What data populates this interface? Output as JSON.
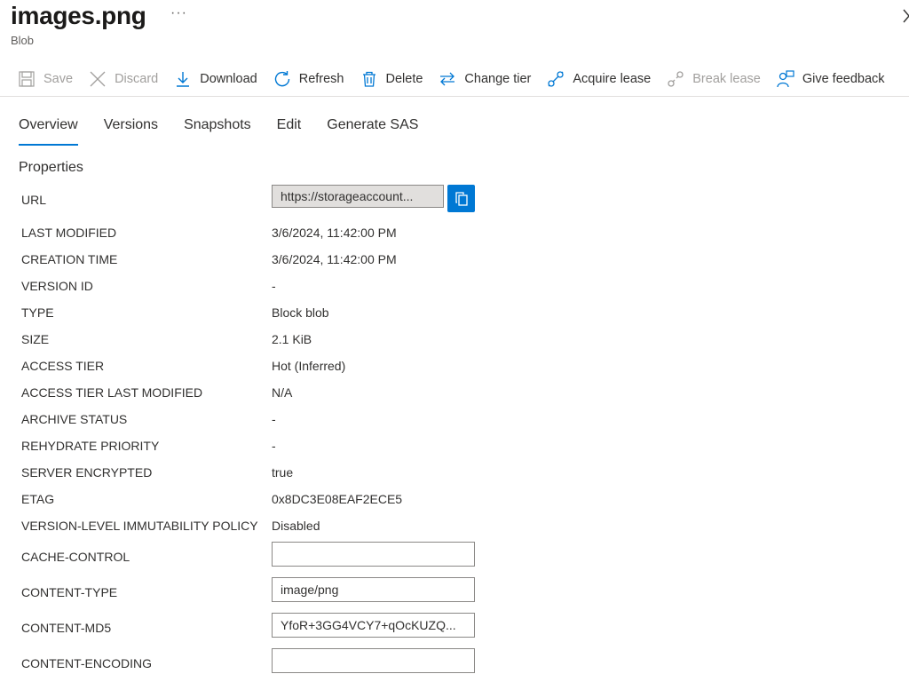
{
  "header": {
    "title": "images.png",
    "more": "···",
    "subtitle": "Blob"
  },
  "toolbar": {
    "save": "Save",
    "discard": "Discard",
    "download": "Download",
    "refresh": "Refresh",
    "delete": "Delete",
    "change_tier": "Change tier",
    "acquire_lease": "Acquire lease",
    "break_lease": "Break lease",
    "give_feedback": "Give feedback"
  },
  "tabs": [
    "Overview",
    "Versions",
    "Snapshots",
    "Edit",
    "Generate SAS"
  ],
  "section_title": "Properties",
  "properties": {
    "url_label": "URL",
    "url_value": "https://storageaccount...",
    "last_modified_label": "LAST MODIFIED",
    "last_modified_value": "3/6/2024, 11:42:00 PM",
    "creation_time_label": "CREATION TIME",
    "creation_time_value": "3/6/2024, 11:42:00 PM",
    "version_id_label": "VERSION ID",
    "version_id_value": "-",
    "type_label": "TYPE",
    "type_value": "Block blob",
    "size_label": "SIZE",
    "size_value": "2.1 KiB",
    "access_tier_label": "ACCESS TIER",
    "access_tier_value": "Hot (Inferred)",
    "access_tier_last_modified_label": "ACCESS TIER LAST MODIFIED",
    "access_tier_last_modified_value": "N/A",
    "archive_status_label": "ARCHIVE STATUS",
    "archive_status_value": "-",
    "rehydrate_priority_label": "REHYDRATE PRIORITY",
    "rehydrate_priority_value": "-",
    "server_encrypted_label": "SERVER ENCRYPTED",
    "server_encrypted_value": "true",
    "etag_label": "ETAG",
    "etag_value": "0x8DC3E08EAF2ECE5",
    "immutability_label": "VERSION-LEVEL IMMUTABILITY POLICY",
    "immutability_value": "Disabled",
    "cache_control_label": "CACHE-CONTROL",
    "cache_control_value": "",
    "content_type_label": "CONTENT-TYPE",
    "content_type_value": "image/png",
    "content_md5_label": "CONTENT-MD5",
    "content_md5_value": "YfoR+3GG4VCY7+qOcKUZQ...",
    "content_encoding_label": "CONTENT-ENCODING",
    "content_encoding_value": ""
  },
  "colors": {
    "accent": "#0078d4",
    "disabled": "#a19f9d"
  }
}
